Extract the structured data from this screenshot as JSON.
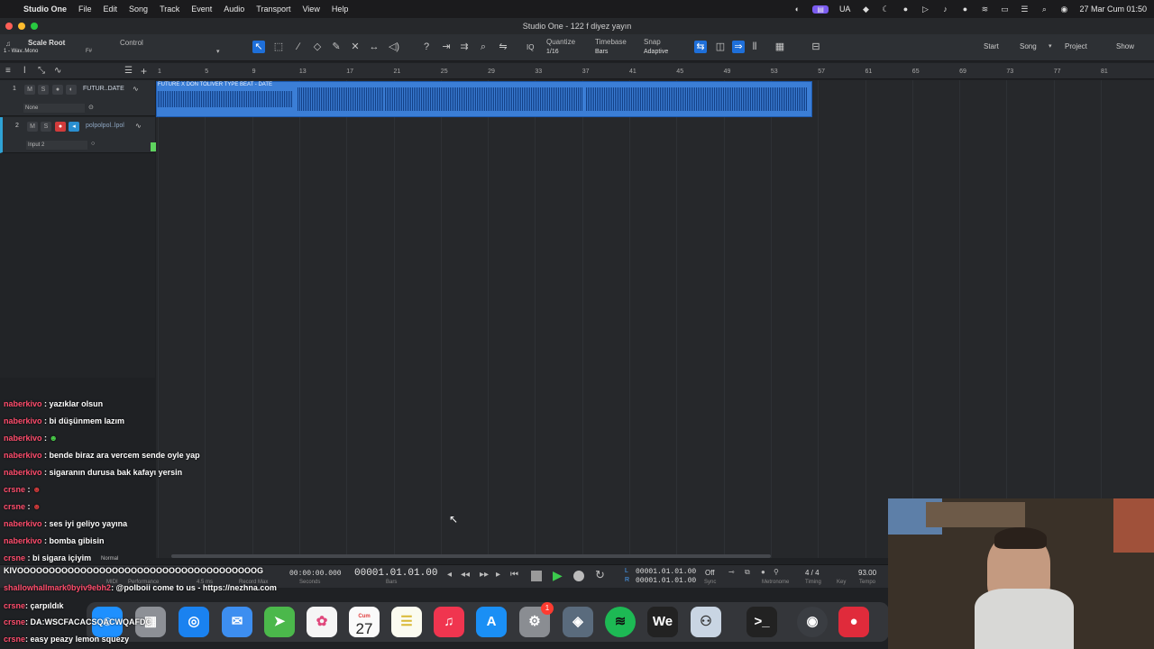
{
  "menubar": {
    "app": "Studio One",
    "items": [
      "File",
      "Edit",
      "Song",
      "Track",
      "Event",
      "Audio",
      "Transport",
      "View",
      "Help"
    ],
    "lang": "UA",
    "datetime": "27 Mar Cum  01:50"
  },
  "window": {
    "title": "Studio One - 122 f diyez yayın"
  },
  "toolbar": {
    "scale_root": "Scale Root",
    "scale_sub": "1 - Wav..Mono",
    "scale_key": "F#",
    "control": "Control",
    "quantize_label": "Quantize",
    "quantize_value": "1/16",
    "timebase_label": "Timebase",
    "timebase_value": "Bars",
    "snap_label": "Snap",
    "snap_value": "Adaptive",
    "iq": "IQ",
    "start": "Start",
    "song": "Song",
    "project": "Project",
    "show": "Show"
  },
  "ruler": {
    "ticks": [
      "1",
      "5",
      "9",
      "13",
      "17",
      "21",
      "25",
      "29",
      "33",
      "37",
      "41",
      "45",
      "49",
      "53",
      "57",
      "61",
      "65",
      "69",
      "73",
      "77",
      "81"
    ]
  },
  "tracks": [
    {
      "num": "1",
      "name": "FUTUR..DATE",
      "input": "None"
    },
    {
      "num": "2",
      "name": "polpolpol..lpol",
      "input": "Input 2"
    }
  ],
  "clip": {
    "name": "FUTURE X DON TOLIVER TYPE BEAT - DATE"
  },
  "chat": [
    {
      "user": "naberkivo",
      "msg": ": yazıklar olsun"
    },
    {
      "user": "naberkivo",
      "msg": ": bi düşünmem lazım"
    },
    {
      "user": "naberkivo",
      "msg": ":"
    },
    {
      "user": "naberkivo",
      "msg": ": bende biraz ara vercem sende oyle yap"
    },
    {
      "user": "naberkivo",
      "msg": ": sigaranın durusa bak kafayı yersin"
    },
    {
      "user": "crsne",
      "msg": ":"
    },
    {
      "user": "crsne",
      "msg": ":"
    },
    {
      "user": "naberkivo",
      "msg": ": ses iyi geliyo yayına"
    },
    {
      "user": "naberkivo",
      "msg": ": bomba gibisin"
    },
    {
      "user": "crsne",
      "msg": ": bi sigara içiyim"
    }
  ],
  "chat_bottom": [
    {
      "user": "",
      "msg": "KIVOOOOOOOOOOOOOOOOOOOOOOOOOOOOOOOOOOOOOOG"
    },
    {
      "user": "shallowhallmark0byiv9ebh2",
      "msg": ": @polboii come to us - https://nezhna.com"
    },
    {
      "user": "crsne",
      "msg": ": çarpıldık"
    },
    {
      "user": "crsne",
      "msg": ": DA:WSCFACACSQACWQAFDC"
    },
    {
      "user": "crsne",
      "msg": ": easy peazy lemon squezy"
    }
  ],
  "transport": {
    "normal": "Normal",
    "seconds_value": "00:00:00.000",
    "seconds_label": "Seconds",
    "bars_value": "00001.01.01.00",
    "bars_label": "Bars",
    "loop_l": "00001.01.01.00",
    "loop_r": "00001.01.01.00",
    "sync_value": "Off",
    "sync_label": "Sync",
    "metronome_label": "Metronome",
    "timing_value": "4 / 4",
    "timing_label": "Timing",
    "key_label": "Key",
    "tempo_value": "93.00",
    "tempo_label": "Tempo",
    "midi": "MIDI",
    "performance": "Performance",
    "record_max": "Record Max",
    "latency": "4.5 ms"
  },
  "dock": {
    "calendar_month": "Cum",
    "calendar_day": "27",
    "settings_badge": "1"
  },
  "colors": {
    "accent": "#1e6fd9",
    "clip": "#3b7ed6",
    "chat_user": "#ff4d6d"
  }
}
